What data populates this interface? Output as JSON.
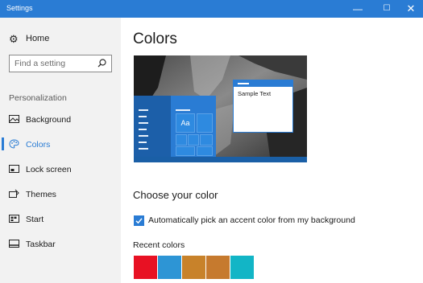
{
  "window": {
    "title": "Settings",
    "controls": {
      "minimize": "—",
      "maximize": "☐",
      "close": "✕"
    }
  },
  "sidebar": {
    "home_label": "Home",
    "search_placeholder": "Find a setting",
    "section_label": "Personalization",
    "items": [
      {
        "label": "Background",
        "icon": "image-icon",
        "active": false
      },
      {
        "label": "Colors",
        "icon": "palette-icon",
        "active": true
      },
      {
        "label": "Lock screen",
        "icon": "lock-screen-icon",
        "active": false
      },
      {
        "label": "Themes",
        "icon": "themes-icon",
        "active": false
      },
      {
        "label": "Start",
        "icon": "start-icon",
        "active": false
      },
      {
        "label": "Taskbar",
        "icon": "taskbar-icon",
        "active": false
      }
    ]
  },
  "main": {
    "title": "Colors",
    "preview": {
      "sample_text": "Sample Text",
      "tile_text": "Aa"
    },
    "section_heading": "Choose your color",
    "auto_accent": {
      "label": "Automatically pick an accent color from my background",
      "checked": true
    },
    "recent_colors_label": "Recent colors",
    "recent_colors": [
      "#e81123",
      "#2d95d5",
      "#c8822a",
      "#c67a2e",
      "#12b5c6"
    ]
  },
  "colors": {
    "accent": "#2a7cd4",
    "sidebar_bg": "#f2f2f2"
  }
}
